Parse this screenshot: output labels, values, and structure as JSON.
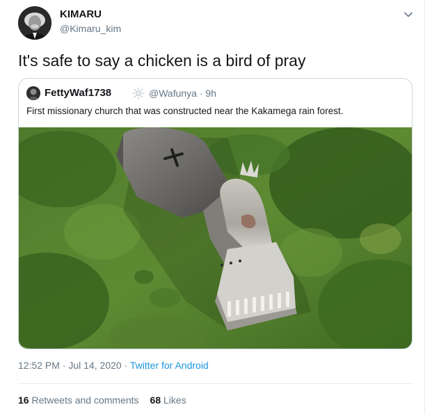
{
  "author": {
    "name": "KIMARU",
    "handle": "@Kimaru_kim"
  },
  "tweet": {
    "text": "It's safe to say a chicken is a bird of pray"
  },
  "quoted": {
    "name": "FettyWaf1738",
    "badge_icon": "sun-badge-icon",
    "handle": "@Wafunya",
    "separator": "·",
    "age": "9h",
    "text": "First missionary church that was constructed near the Kakamega rain forest."
  },
  "meta": {
    "time": "12:52 PM",
    "date": "Jul 14, 2020",
    "separator": "·",
    "source": "Twitter for Android"
  },
  "stats": {
    "retweets_count": "16",
    "retweets_label": "Retweets and comments",
    "likes_count": "68",
    "likes_label": "Likes"
  },
  "colors": {
    "link": "#1b95e0",
    "secondary_text": "#657786",
    "primary_text": "#14171a",
    "border": "#ccd6dd"
  }
}
